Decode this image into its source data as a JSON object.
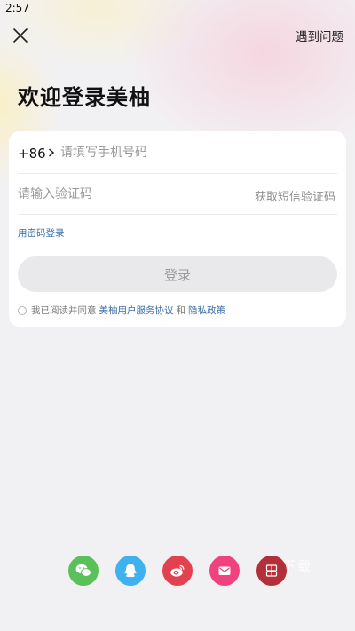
{
  "status_bar": {
    "time": "2:57"
  },
  "header": {
    "help_label": "遇到问题"
  },
  "title": "欢迎登录美柚",
  "form": {
    "country_code": "+86",
    "phone_placeholder": "请填写手机号码",
    "code_placeholder": "请输入验证码",
    "get_code_label": "获取短信验证码",
    "password_login_label": "用密码登录",
    "login_button_label": "登录",
    "agreement": {
      "prefix": "我已阅读并同意",
      "terms_link": "美柚用户服务协议",
      "conjunction": "和",
      "privacy_link": "隐私政策",
      "checked": false
    }
  },
  "social_logins": [
    {
      "name": "wechat",
      "icon": "wechat-icon",
      "color": "#5ac05a"
    },
    {
      "name": "qq",
      "icon": "qq-icon",
      "color": "#3fb1ef"
    },
    {
      "name": "weibo",
      "icon": "weibo-icon",
      "color": "#e2424f"
    },
    {
      "name": "email",
      "icon": "mail-icon",
      "color": "#f0427c"
    },
    {
      "name": "other",
      "icon": "badge-icon",
      "color": "#b3303a"
    }
  ],
  "watermark": {
    "text": "下载"
  },
  "colors": {
    "link": "#3e6ea8",
    "button_disabled_bg": "#e9e9ec",
    "page_bg": "#f1f1f4"
  }
}
